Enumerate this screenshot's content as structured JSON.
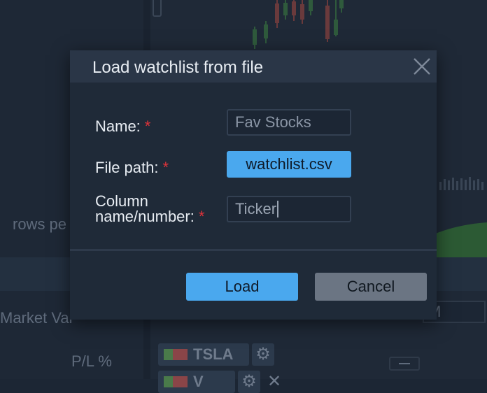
{
  "background": {
    "rows_per_label": "rows pe",
    "market_value_label": "Market Val",
    "pl_label": "P/L %",
    "tickers": [
      "TSLA",
      "V"
    ],
    "field_partial": "M"
  },
  "dialog": {
    "title": "Load watchlist from file",
    "close_icon": "close-icon",
    "required_mark": "*",
    "fields": {
      "name": {
        "label": "Name:",
        "value": "Fav Stocks"
      },
      "file_path": {
        "label": "File path:",
        "value": "watchlist.csv"
      },
      "column": {
        "label_line1": "Column",
        "label_line2": "name/number:",
        "value": "Ticker"
      }
    },
    "buttons": {
      "load": "Load",
      "cancel": "Cancel"
    }
  },
  "colors": {
    "accent": "#4aa8ee",
    "required": "#e0333a",
    "dialog_bg": "#1f2a38",
    "header_bg": "#2a3647"
  }
}
